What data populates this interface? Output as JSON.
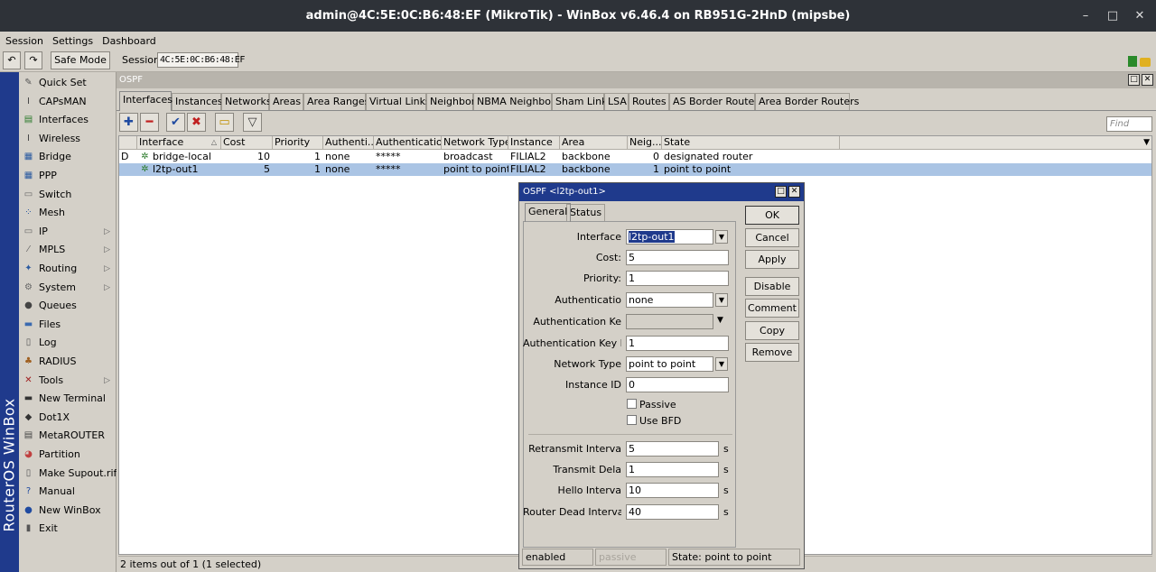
{
  "window": {
    "title": "admin@4C:5E:0C:B6:48:EF (MikroTik) - WinBox v6.46.4 on RB951G-2HnD (mipsbe)",
    "min": "–",
    "max": "□",
    "close": "✕"
  },
  "menu": [
    "Session",
    "Settings",
    "Dashboard"
  ],
  "toolbar": {
    "undo": "↶",
    "redo": "↷",
    "safe_mode": "Safe Mode",
    "session_label": "Session",
    "session_value": "4C:5E:0C:B6:48:EF"
  },
  "vertical_label": "RouterOS WinBox",
  "sidebar": [
    {
      "label": "Quick Set",
      "icon": "quick-set-icon",
      "glyph": "✎",
      "color": "#555",
      "arrow": ""
    },
    {
      "label": "CAPsMAN",
      "icon": "capsman-icon",
      "glyph": "Ⅰ",
      "color": "#444",
      "arrow": ""
    },
    {
      "label": "Interfaces",
      "icon": "interfaces-icon",
      "glyph": "▤",
      "color": "#2a7a2a",
      "arrow": ""
    },
    {
      "label": "Wireless",
      "icon": "wireless-icon",
      "glyph": "Ⅰ",
      "color": "#444",
      "arrow": ""
    },
    {
      "label": "Bridge",
      "icon": "bridge-icon",
      "glyph": "▦",
      "color": "#2a5aa0",
      "arrow": ""
    },
    {
      "label": "PPP",
      "icon": "ppp-icon",
      "glyph": "▦",
      "color": "#2a5aa0",
      "arrow": ""
    },
    {
      "label": "Switch",
      "icon": "switch-icon",
      "glyph": "▭",
      "color": "#666",
      "arrow": ""
    },
    {
      "label": "Mesh",
      "icon": "mesh-icon",
      "glyph": "⁘",
      "color": "#2a5aa0",
      "arrow": ""
    },
    {
      "label": "IP",
      "icon": "ip-icon",
      "glyph": "▭",
      "color": "#666",
      "arrow": "▷"
    },
    {
      "label": "MPLS",
      "icon": "mpls-icon",
      "glyph": "⁄",
      "color": "#666",
      "arrow": "▷"
    },
    {
      "label": "Routing",
      "icon": "routing-icon",
      "glyph": "✦",
      "color": "#2a5aa0",
      "arrow": "▷"
    },
    {
      "label": "System",
      "icon": "system-icon",
      "glyph": "⚙",
      "color": "#666",
      "arrow": "▷"
    },
    {
      "label": "Queues",
      "icon": "queues-icon",
      "glyph": "●",
      "color": "#444",
      "arrow": ""
    },
    {
      "label": "Files",
      "icon": "files-icon",
      "glyph": "▬",
      "color": "#3a6ab0",
      "arrow": ""
    },
    {
      "label": "Log",
      "icon": "log-icon",
      "glyph": "▯",
      "color": "#555",
      "arrow": ""
    },
    {
      "label": "RADIUS",
      "icon": "radius-icon",
      "glyph": "♣",
      "color": "#a06020",
      "arrow": ""
    },
    {
      "label": "Tools",
      "icon": "tools-icon",
      "glyph": "✕",
      "color": "#a02020",
      "arrow": "▷"
    },
    {
      "label": "New Terminal",
      "icon": "terminal-icon",
      "glyph": "▬",
      "color": "#333",
      "arrow": ""
    },
    {
      "label": "Dot1X",
      "icon": "dot1x-icon",
      "glyph": "◆",
      "color": "#333",
      "arrow": ""
    },
    {
      "label": "MetaROUTER",
      "icon": "metarouter-icon",
      "glyph": "▤",
      "color": "#444",
      "arrow": ""
    },
    {
      "label": "Partition",
      "icon": "partition-icon",
      "glyph": "◕",
      "color": "#c04040",
      "arrow": ""
    },
    {
      "label": "Make Supout.rif",
      "icon": "supout-icon",
      "glyph": "▯",
      "color": "#555",
      "arrow": ""
    },
    {
      "label": "Manual",
      "icon": "manual-icon",
      "glyph": "?",
      "color": "#1f4aa0",
      "arrow": ""
    },
    {
      "label": "New WinBox",
      "icon": "new-winbox-icon",
      "glyph": "●",
      "color": "#1f4aa0",
      "arrow": ""
    },
    {
      "label": "Exit",
      "icon": "exit-icon",
      "glyph": "▮",
      "color": "#555",
      "arrow": ""
    }
  ],
  "ospf": {
    "title": "OSPF",
    "tabs": [
      "Interfaces",
      "Instances",
      "Networks",
      "Areas",
      "Area Ranges",
      "Virtual Links",
      "Neighbors",
      "NBMA Neighbors",
      "Sham Links",
      "LSA",
      "Routes",
      "AS Border Routers",
      "Area Border Routers"
    ],
    "active_tab": "Interfaces",
    "find_placeholder": "Find",
    "columns": [
      "",
      "Interface",
      "Cost",
      "Priority",
      "Authenti...",
      "Authenticatio...",
      "Network Type",
      "Instance",
      "Area",
      "Neig...",
      "State"
    ],
    "sort_indicator": "△",
    "rows": [
      {
        "flag": "D",
        "interface": "bridge-local",
        "cost": "10",
        "priority": "1",
        "auth": "none",
        "auth_key": "*****",
        "network_type": "broadcast",
        "instance": "FILIAL2",
        "area": "backbone",
        "neighbors": "0",
        "state": "designated router",
        "selected": false
      },
      {
        "flag": "",
        "interface": "l2tp-out1",
        "cost": "5",
        "priority": "1",
        "auth": "none",
        "auth_key": "*****",
        "network_type": "point to point",
        "instance": "FILIAL2",
        "area": "backbone",
        "neighbors": "1",
        "state": "point to point",
        "selected": true
      }
    ],
    "status": "2 items out of 1 (1 selected)"
  },
  "dialog": {
    "title": "OSPF <l2tp-out1>",
    "tabs": [
      "General",
      "Status"
    ],
    "fields": {
      "interface": {
        "label": "Interface",
        "value": "l2tp-out1"
      },
      "cost": {
        "label": "Cost:",
        "value": "5"
      },
      "priority": {
        "label": "Priority:",
        "value": "1"
      },
      "authentication": {
        "label": "Authenticatio",
        "value": "none"
      },
      "auth_key": {
        "label": "Authentication Ke",
        "value": ""
      },
      "auth_key_id": {
        "label": "Authentication Key I",
        "value": "1"
      },
      "network_type": {
        "label": "Network Type",
        "value": "point to point"
      },
      "instance_id": {
        "label": "Instance ID",
        "value": "0"
      },
      "retransmit": {
        "label": "Retransmit Interva",
        "value": "5",
        "unit": "s"
      },
      "transmit_delay": {
        "label": "Transmit Dela",
        "value": "1",
        "unit": "s"
      },
      "hello": {
        "label": "Hello Interva",
        "value": "10",
        "unit": "s"
      },
      "dead": {
        "label": "Router Dead Interva",
        "value": "40",
        "unit": "s"
      }
    },
    "passive_label": "Passive",
    "bfd_label": "Use BFD",
    "buttons": [
      "OK",
      "Cancel",
      "Apply",
      "Disable",
      "Comment",
      "Copy",
      "Remove"
    ],
    "status": [
      "enabled",
      "passive",
      "State: point to point"
    ]
  },
  "colors": {
    "accent": "#1f3a8c",
    "selection": "#aac4e4",
    "add": "#1f4aa0",
    "remove": "#c02020",
    "enable": "#1f4aa0",
    "disable": "#c02020"
  }
}
